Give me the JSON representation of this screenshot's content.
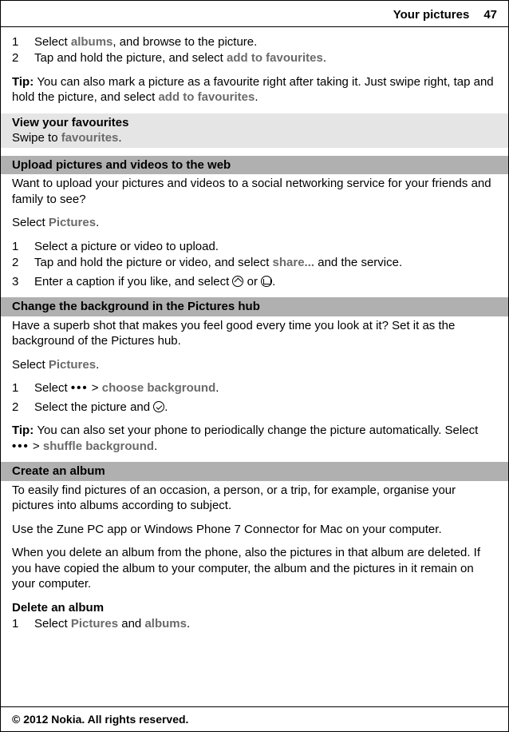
{
  "header": {
    "title": "Your pictures",
    "page": "47"
  },
  "steps1": {
    "n1": "1",
    "t1a": "Select ",
    "t1b": "albums",
    "t1c": ", and browse to the picture.",
    "n2": "2",
    "t2a": "Tap and hold the picture, and select ",
    "t2b": "add to favourites",
    "t2c": "."
  },
  "tip1": {
    "label": "Tip: ",
    "a": "You can also mark a picture as a favourite right after taking it. Just swipe right, tap and hold the picture, and select ",
    "b": "add to favourites",
    "c": "."
  },
  "viewfav": {
    "head": "View your favourites",
    "a": "Swipe to ",
    "b": "favourites",
    "c": "."
  },
  "upload": {
    "head": "Upload pictures and videos to the web",
    "intro": "Want to upload your pictures and videos to a social networking service for your friends and family to see?",
    "sa": "Select ",
    "sb": "Pictures",
    "sc": ".",
    "n1": "1",
    "t1": "Select a picture or video to upload.",
    "n2": "2",
    "t2a": "Tap and hold the picture or video, and select ",
    "t2b": "share...",
    "t2c": " and the service.",
    "n3": "3",
    "t3a": "Enter a caption if you like, and select ",
    "t3or": " or ",
    "t3end": "."
  },
  "bg": {
    "head": "Change the background in the Pictures hub",
    "intro": "Have a superb shot that makes you feel good every time you look at it? Set it as the background of the Pictures hub.",
    "sa": "Select ",
    "sb": "Pictures",
    "sc": ".",
    "n1": "1",
    "t1a": "Select ",
    "t1b": " > ",
    "t1c": "choose background",
    "t1d": ".",
    "n2": "2",
    "t2a": "Select the picture and ",
    "t2b": "."
  },
  "tip2": {
    "label": "Tip: ",
    "a": "You can also set your phone to periodically change the picture automatically. Select",
    "b": " > ",
    "c": "shuffle background",
    "d": "."
  },
  "album": {
    "head": "Create an album",
    "p1": "To easily find pictures of an occasion, a person, or a trip, for example, organise your pictures into albums according to subject.",
    "p2": "Use the Zune PC app or Windows Phone 7 Connector for Mac on your computer.",
    "p3": "When you delete an album from the phone, also the pictures in that album are deleted. If you have copied the album to your computer, the album and the pictures in it remain on your computer.",
    "delhead": "Delete an album",
    "n1": "1",
    "t1a": "Select ",
    "t1b": "Pictures",
    "t1c": " and ",
    "t1d": "albums",
    "t1e": "."
  },
  "footer": "© 2012 Nokia. All rights reserved."
}
